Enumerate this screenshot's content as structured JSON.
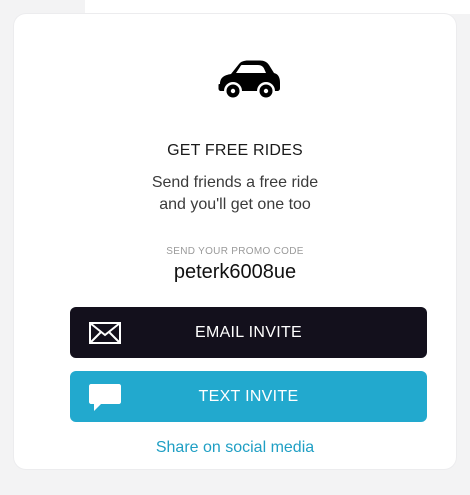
{
  "referral": {
    "icon": "car-icon",
    "heading": "GET FREE RIDES",
    "subtitle_line1": "Send friends a free ride",
    "subtitle_line2": "and you'll get one too",
    "promo_label": "SEND YOUR PROMO CODE",
    "promo_code": "peterk6008ue"
  },
  "actions": {
    "email": {
      "label": "EMAIL INVITE",
      "icon": "envelope-icon",
      "color": "#13101c"
    },
    "text": {
      "label": "TEXT INVITE",
      "icon": "chat-bubble-icon",
      "color": "#22a9ce"
    },
    "share_label": "Share on social media",
    "link_color": "#1f9fc4"
  }
}
